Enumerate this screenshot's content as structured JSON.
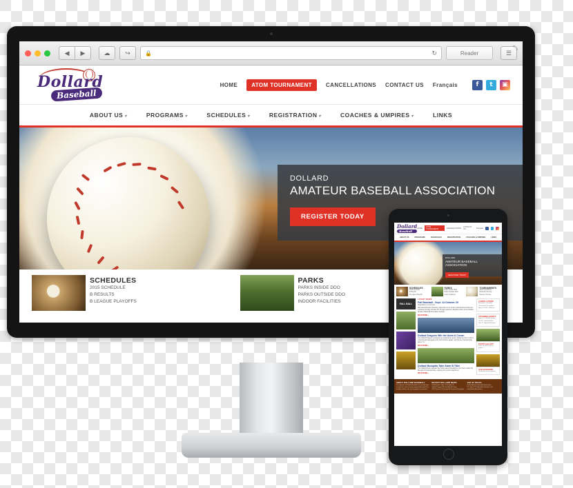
{
  "scene": {
    "description": "Responsive website mockup shown on an iMac desktop and an iPad tablet"
  },
  "browser": {
    "window_buttons": [
      "close",
      "minimize",
      "zoom"
    ],
    "back_label": "◀",
    "forward_label": "▶",
    "cloud_label": "☁",
    "share_label": "↪",
    "address_value": "",
    "address_lock_icon": "🔒",
    "reload_label": "↻",
    "reader_label": "Reader",
    "bookmark_label": "☰",
    "resize_label": "⤡"
  },
  "site": {
    "logo": {
      "name": "Dollard",
      "sub": "Baseball"
    },
    "top_nav": [
      {
        "label": "HOME",
        "highlight": false
      },
      {
        "label": "ATOM TOURNAMENT",
        "highlight": true
      },
      {
        "label": "CANCELLATIONS",
        "highlight": false
      },
      {
        "label": "CONTACT US",
        "highlight": false
      },
      {
        "label": "Français",
        "highlight": false
      }
    ],
    "social": [
      {
        "name": "facebook",
        "glyph": "f"
      },
      {
        "name": "twitter",
        "glyph": "t"
      },
      {
        "name": "instagram",
        "glyph": "▣"
      }
    ],
    "main_nav": [
      {
        "label": "ABOUT US",
        "caret": true
      },
      {
        "label": "PROGRAMS",
        "caret": true
      },
      {
        "label": "SCHEDULES",
        "caret": true
      },
      {
        "label": "REGISTRATION",
        "caret": true
      },
      {
        "label": "COACHES & UMPIRES",
        "caret": true
      },
      {
        "label": "LINKS",
        "caret": false
      }
    ],
    "hero": {
      "kicker": "DOLLARD",
      "title": "AMATEUR BASEBALL ASSOCIATION",
      "button": "REGISTER TODAY"
    },
    "promos": [
      {
        "image": "baseball-glove",
        "heading": "SCHEDULES",
        "lines": [
          "2015 SCHEDULE",
          "B RESULTS",
          "B LEAGUE PLAYOFFS"
        ]
      },
      {
        "image": "youth-player",
        "heading": "PARKS",
        "lines": [
          "PARKS INSIDE DDO",
          "PARKS OUTSIDE DDO",
          "INDOOR FACILITIES"
        ]
      },
      {
        "image": "baseballs",
        "heading": "",
        "lines": []
      }
    ]
  },
  "tablet": {
    "promos": [
      {
        "heading": "SCHEDULES",
        "lines": [
          "2015 Schedule",
          "B Results",
          "B League Playoffs"
        ]
      },
      {
        "heading": "PARKS",
        "lines": [
          "Parks Inside DDO",
          "Parks Outside DDO",
          "Indoor Facilities"
        ]
      },
      {
        "heading": "TOURNAMENTS",
        "lines": [
          "Atom Tournament",
          "Mosquito Tourney",
          "Peewee Tourney"
        ]
      }
    ],
    "left_banner": "FALL BALL",
    "news": {
      "section_label": "LATEST NEWS",
      "articles": [
        {
          "title": "Fall Baseball - Sept. 12-October 25",
          "meta": "Registration is now open",
          "body": "Fall baseball starts Saturday, September 12 at 10 am at Westminster Park and continues Sunday, October 25. All ages welcome. Register online at the Dollard Amateur Baseball Association website.",
          "more": "READ MORE »"
        },
        {
          "title": "Dollard Dragons Win the Atom A Crown",
          "body": "The Dollard Dragons completed an outstanding season taking the Atom A title in a hard-fought final against the host Lachine squad, winning the championship game 7-3.",
          "more": "READ MORE »"
        },
        {
          "title": "Dollard Mosquito Take Atom B Title!",
          "body": "The Dollard Power defeated the Saint-Laurent Redbirds in the final to claim the Mosquito B championship, capping off a perfect playoff run.",
          "more": "READ MORE »"
        }
      ]
    },
    "sidebar": [
      {
        "title": "CANCELLATIONS",
        "lines": [
          "No games cancelled",
          "Check back for updates",
          "Aug 21, 2015 - 6:30 p.m."
        ]
      },
      {
        "title": "UPCOMING EVENTS",
        "lines": [
          "Sept 12 - Fall Ball Opens",
          "Oct 25 - Season Ends",
          "Nov 07 - Awards Banquet"
        ]
      },
      {
        "title": "PHOTO GALLERY",
        "lines": [
          "View our 2015 season photos"
        ]
      },
      {
        "title": "OUR SPONSORS",
        "lines": [
          "Thank you to our partners"
        ]
      }
    ],
    "footer": [
      {
        "title": "ABOUT DOLLARD BASEBALL",
        "lines": [
          "The objective of Dollard Baseball is to provide boys and girls the chance to play organized baseball in a friendly, healthy, safe and enjoyable environment."
        ]
      },
      {
        "title": "RECENT DOLLARD NEWS",
        "lines": [
          "Fall Baseball - Sept. 12-October 25",
          "Dollard Dragons Win the Atom A Crown",
          "2015 Season & Tournament Provincial Recognition"
        ]
      },
      {
        "title": "GET IN TOUCH",
        "lines": [
          "Dollard Amateur Baseball Association",
          "P.O. Box 123, Dollard-des-Ormeaux, QC",
          "info@dollardbaseball.ca"
        ]
      }
    ]
  }
}
